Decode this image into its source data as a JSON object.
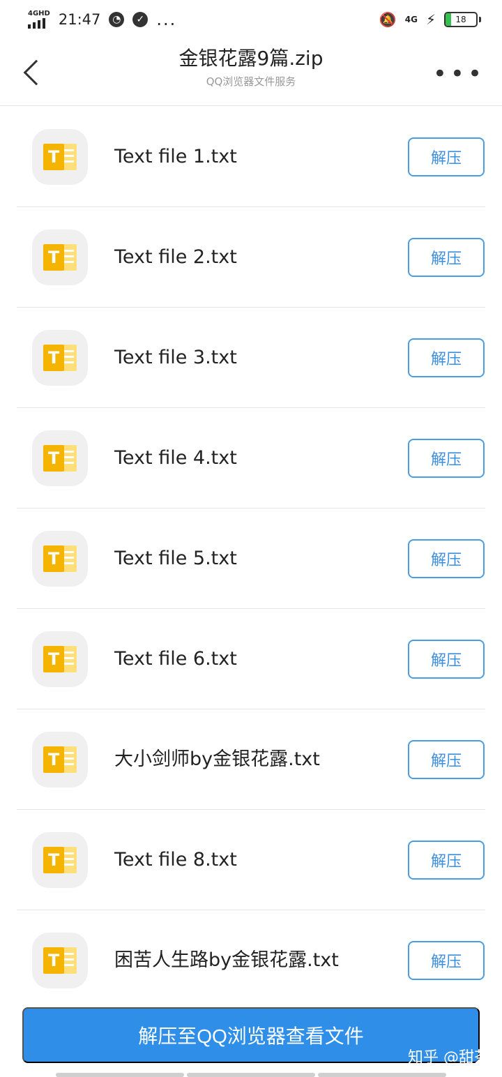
{
  "status_bar": {
    "network_left": "4GHD",
    "time": "21:47",
    "more": "...",
    "network_right": "4G",
    "battery": "18"
  },
  "header": {
    "title": "金银花露9篇.zip",
    "subtitle": "QQ浏览器文件服务"
  },
  "list": {
    "items": [
      {
        "name": "Text file 1.txt",
        "action": "解压"
      },
      {
        "name": "Text file 2.txt",
        "action": "解压"
      },
      {
        "name": "Text file 3.txt",
        "action": "解压"
      },
      {
        "name": "Text file 4.txt",
        "action": "解压"
      },
      {
        "name": "Text file 5.txt",
        "action": "解压"
      },
      {
        "name": "Text file 6.txt",
        "action": "解压"
      },
      {
        "name": "大小剑师by金银花露.txt",
        "action": "解压"
      },
      {
        "name": "Text file 8.txt",
        "action": "解压"
      },
      {
        "name": "困苦人生路by金银花露.txt",
        "action": "解压"
      }
    ]
  },
  "bottom": {
    "primary_action": "解压至QQ浏览器查看文件",
    "watermark": "知乎 @甜茶"
  },
  "colors": {
    "accent": "#2f8ee8",
    "button_border": "#4a9de3"
  }
}
